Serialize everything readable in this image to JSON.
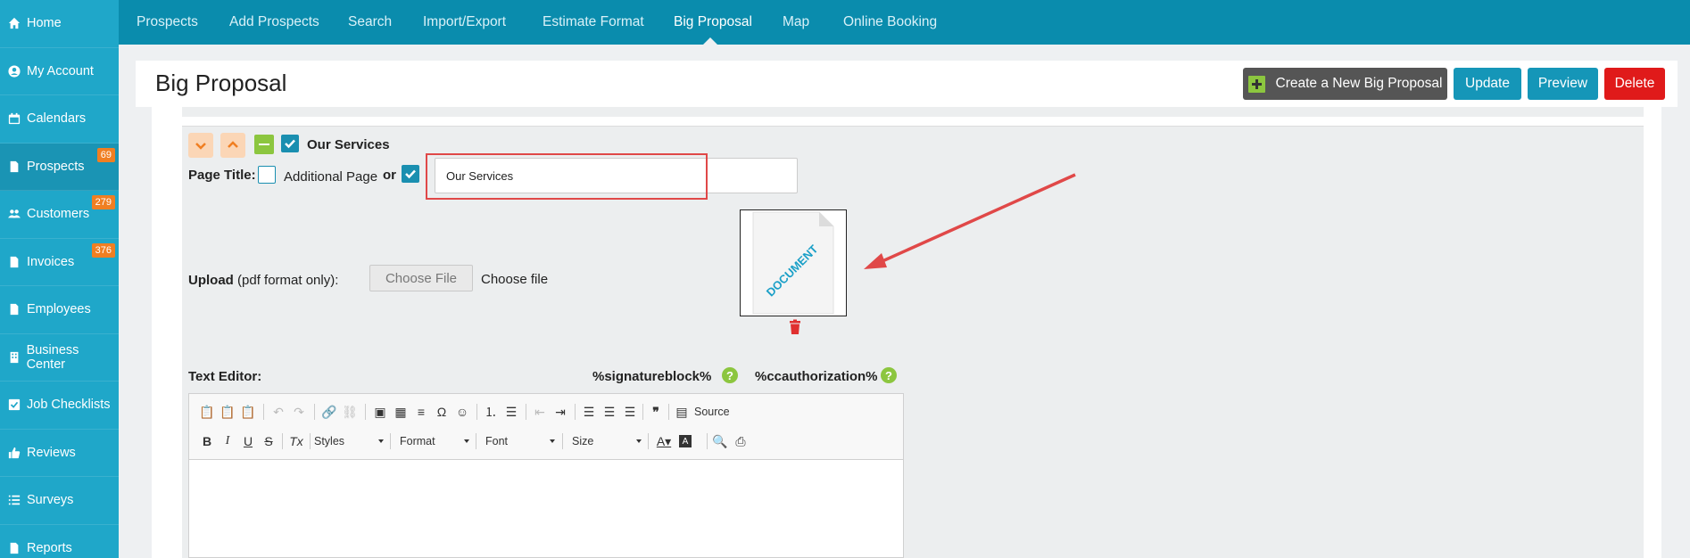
{
  "sidebar": {
    "items": [
      {
        "label": "Home",
        "icon": "home-icon"
      },
      {
        "label": "My Account",
        "icon": "user-circle-icon"
      },
      {
        "label": "Calendars",
        "icon": "calendar-icon"
      },
      {
        "label": "Prospects",
        "icon": "file-icon",
        "badge": "69"
      },
      {
        "label": "Customers",
        "icon": "users-icon",
        "badge": "279"
      },
      {
        "label": "Invoices",
        "icon": "file-icon",
        "badge": "376"
      },
      {
        "label": "Employees",
        "icon": "file-icon"
      },
      {
        "label": "Business Center",
        "icon": "building-icon"
      },
      {
        "label": "Job Checklists",
        "icon": "checkbox-icon"
      },
      {
        "label": "Reviews",
        "icon": "thumbs-up-icon"
      },
      {
        "label": "Surveys",
        "icon": "list-icon"
      },
      {
        "label": "Reports",
        "icon": "file-icon"
      }
    ]
  },
  "topnav": {
    "links": [
      "Prospects",
      "Add Prospects",
      "Search",
      "Import/Export",
      "Estimate Format",
      "Big Proposal",
      "Map",
      "Online Booking"
    ],
    "active": "Big Proposal"
  },
  "header": {
    "title": "Big Proposal",
    "create_label": "Create a New Big Proposal",
    "update_label": "Update",
    "preview_label": "Preview",
    "delete_label": "Delete"
  },
  "section": {
    "name": "Our Services",
    "page_title_label": "Page Title:",
    "additional_page_label": "Additional Page",
    "or_label": "or",
    "title_value": "Our Services",
    "upload_label": "Upload",
    "upload_hint": "(pdf format only):",
    "choose_file_button": "Choose File",
    "choose_file_status": "Choose file",
    "document_text": "DOCUMENT",
    "text_editor_label": "Text Editor:",
    "signature_token": "%signatureblock%",
    "ccauth_token": "%ccauthorization%"
  },
  "editor": {
    "source_label": "Source",
    "styles_label": "Styles",
    "format_label": "Format",
    "font_label": "Font",
    "size_label": "Size"
  },
  "colors": {
    "sidebar": "#1fa7c9",
    "topnav": "#0a8cad",
    "accent_blue": "#1596b8",
    "danger": "#e01a1a",
    "badge": "#f07f22",
    "help_green": "#8cc63f"
  }
}
